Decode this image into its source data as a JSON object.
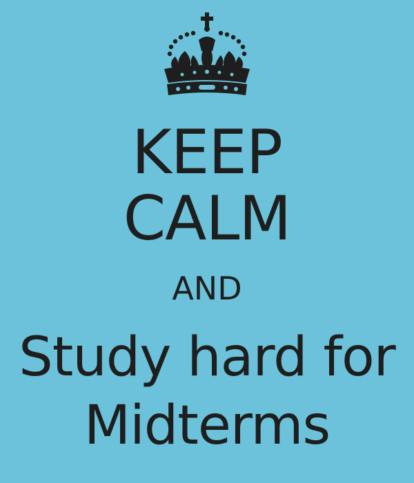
{
  "colors": {
    "background": "#6bc2da",
    "text": "#1e1e1e"
  },
  "crown": {
    "icon": "crown-icon"
  },
  "lines": {
    "keep": "KEEP",
    "calm": "CALM",
    "and": "AND",
    "line4": "Study hard for",
    "line5": "Midterms"
  }
}
